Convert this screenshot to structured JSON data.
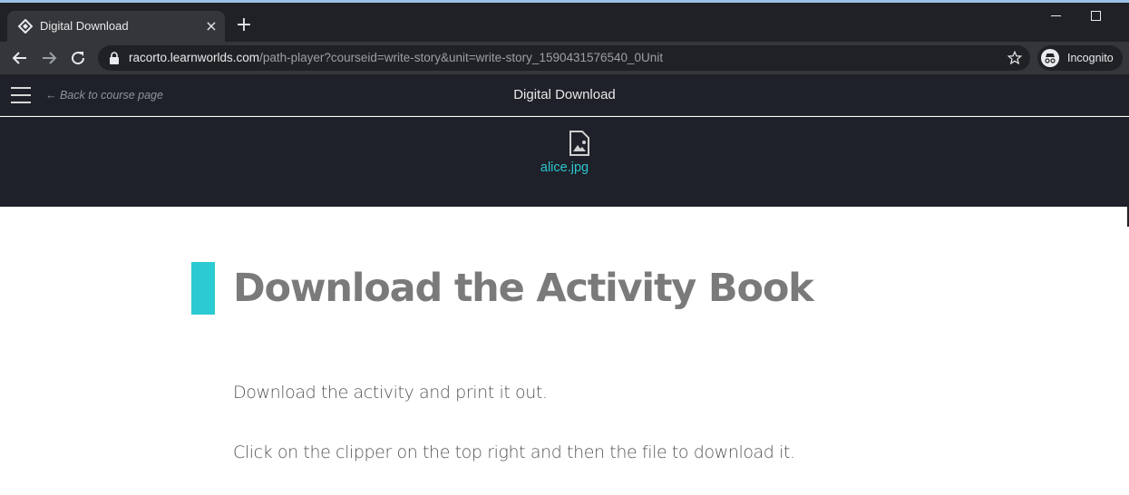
{
  "browser": {
    "tab_title": "Digital Download",
    "tab_close": "×",
    "new_tab": "+",
    "url_host": "racorto.learnworlds.com",
    "url_path": "/path-player?courseid=write-story&unit=write-story_1590431576540_0Unit",
    "incognito_label": "Incognito"
  },
  "player": {
    "back_label": "← Back to course page",
    "title": "Digital Download",
    "file_name": "alice.jpg"
  },
  "content": {
    "heading": "Download the Activity Book",
    "paragraphs": [
      "Download the activity and print it out.",
      "Click on the clipper on the top right and then the file to download it."
    ]
  },
  "colors": {
    "accent": "#2ccad2",
    "player_bg": "#1e2129",
    "file_link": "#2ec4cf"
  },
  "icons": {
    "tab_favicon": "learnworlds-logo-icon",
    "lock": "lock-icon",
    "star": "star-icon",
    "incognito": "incognito-icon",
    "menu": "hamburger-icon",
    "file": "image-file-icon"
  }
}
